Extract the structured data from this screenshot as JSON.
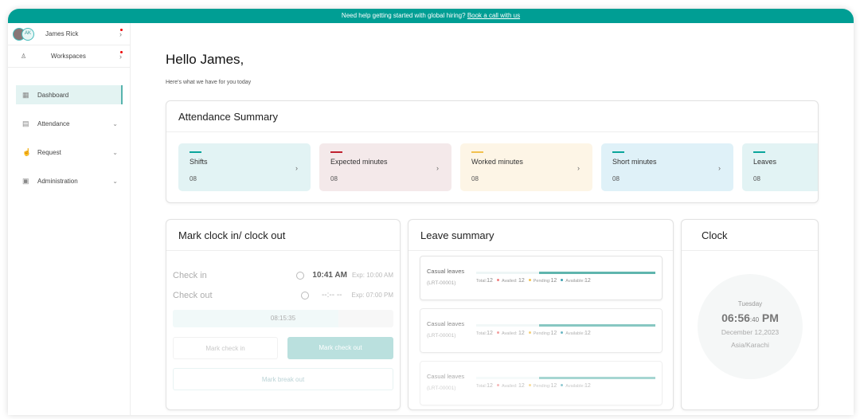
{
  "banner": {
    "text": "Need help getting started with global hiring?",
    "link": "Book a call with us"
  },
  "sidebar": {
    "user": {
      "name": "James Rick",
      "initials": "AK"
    },
    "workspaces": "Workspaces",
    "items": [
      {
        "label": "Dashboard",
        "icon": "grid-icon"
      },
      {
        "label": "Attendance",
        "icon": "calendar-icon"
      },
      {
        "label": "Request",
        "icon": "hand-icon"
      },
      {
        "label": "Administration",
        "icon": "admin-icon"
      }
    ]
  },
  "greeting": "Hello James,",
  "subtitle": "Here's what we have for you today",
  "attendance": {
    "title": "Attendance Summary",
    "cards": [
      {
        "label": "Shifts",
        "value": "08",
        "color": "#0aa59b",
        "bg": "#e2f3f4"
      },
      {
        "label": "Expected minutes",
        "value": "08",
        "color": "#c0202f",
        "bg": "#f4e9ea"
      },
      {
        "label": "Worked minutes",
        "value": "08",
        "color": "#f2c14e",
        "bg": "#fdf5e6"
      },
      {
        "label": "Short minutes",
        "value": "08",
        "color": "#0aa59b",
        "bg": "#dff1f8"
      },
      {
        "label": "Leaves",
        "value": "08",
        "color": "#0aa59b",
        "bg": "#e2f3f4"
      }
    ]
  },
  "clockio": {
    "title": "Mark clock in/ clock out",
    "check_in": {
      "label": "Check in",
      "time": "10:41 AM",
      "expected": "Exp: 10:00 AM"
    },
    "check_out": {
      "label": "Check out",
      "time": "--:-- --",
      "expected": "Exp: 07:00 PM"
    },
    "elapsed": "08:15:35",
    "progress": 0.75,
    "mark_in": "Mark check in",
    "mark_out": "Mark check out",
    "break_out": "Mark break out"
  },
  "leave": {
    "title": "Leave summary",
    "items": [
      {
        "name": "Casual leaves",
        "code": "(LRT-00001)",
        "total": "Total:",
        "total_v": "12",
        "availed": "Availed:",
        "availed_v": "12",
        "pending": "Pending:",
        "pending_v": "12",
        "available": "Available:",
        "available_v": "12",
        "used_fraction": 0.65
      },
      {
        "name": "Casual leaves",
        "code": "(LRT-00001)",
        "total": "Total:",
        "total_v": "12",
        "availed": "Availed:",
        "availed_v": "12",
        "pending": "Pending:",
        "pending_v": "12",
        "available": "Available:",
        "available_v": "12",
        "used_fraction": 0.65
      },
      {
        "name": "Casual leaves",
        "code": "(LRT-00001)",
        "total": "Total:",
        "total_v": "12",
        "availed": "Availed:",
        "availed_v": "12",
        "pending": "Pending:",
        "pending_v": "12",
        "available": "Available:",
        "available_v": "12",
        "used_fraction": 0.65
      }
    ]
  },
  "clock": {
    "title": "Clock",
    "day": "Tuesday",
    "hm": "06:56",
    "sec": ":40",
    "ampm": " PM",
    "date": "December 12,2023",
    "tz": "Asia/Karachi"
  }
}
